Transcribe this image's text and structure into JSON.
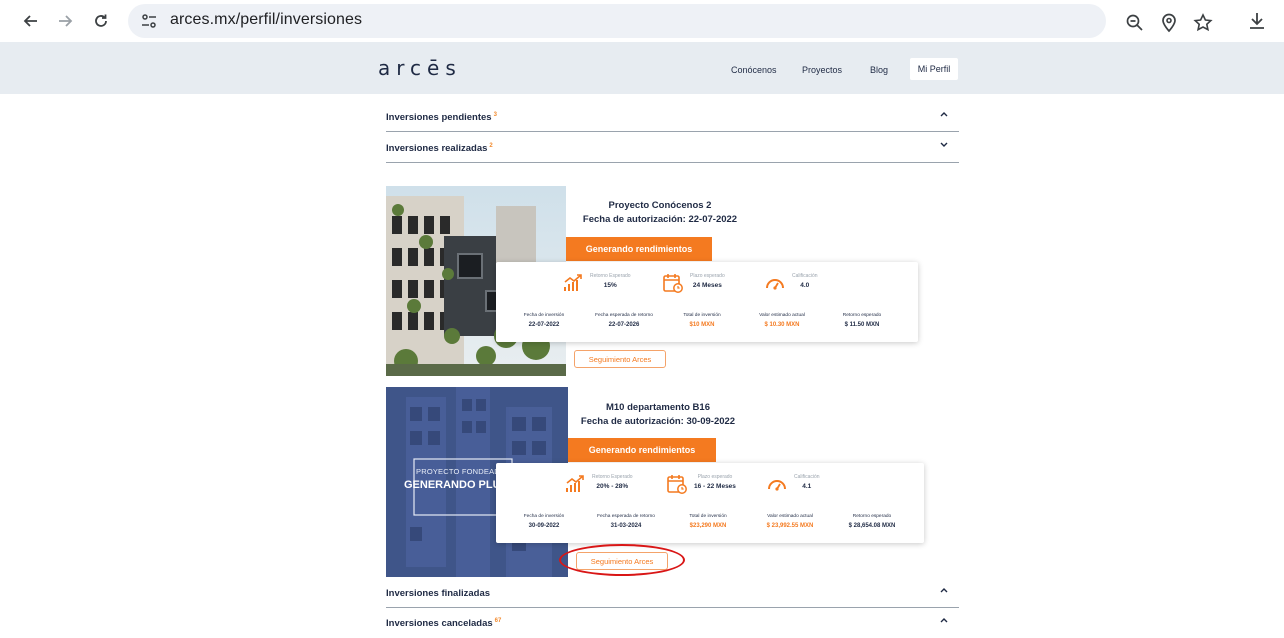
{
  "browser": {
    "url": "arces.mx/perfil/inversiones"
  },
  "site": {
    "logo": "arcēs",
    "nav": [
      "Conócenos",
      "Proyectos",
      "Blog"
    ],
    "profile_button": "Mi Perfil"
  },
  "sections": {
    "pending": {
      "label": "Inversiones pendientes",
      "count": "3"
    },
    "realized": {
      "label": "Inversiones realizadas",
      "count": "2"
    },
    "finished": {
      "label": "Inversiones finalizadas",
      "count": ""
    },
    "cancelled": {
      "label": "Inversiones canceladas",
      "count": "67"
    }
  },
  "projects": [
    {
      "name": "Proyecto Conócenos 2",
      "authorization": "Fecha de autorización: 22-07-2022",
      "status": "Generando rendimientos",
      "metrics": [
        {
          "label": "Retorno Esperado",
          "value": "15%"
        },
        {
          "label": "Plazo esperado",
          "value": "24 Meses"
        },
        {
          "label": "Calificación",
          "value": "4.0"
        }
      ],
      "columns": [
        {
          "label": "Fecha de inversión",
          "value": "22-07-2022"
        },
        {
          "label": "Fecha esperada de retorno",
          "value": "22-07-2026"
        },
        {
          "label": "Total de inversión",
          "value": "$10 MXN"
        },
        {
          "label": "Valor estimado actual",
          "value": "$ 10.30 MXN"
        },
        {
          "label": "Retorno esperado",
          "value": "$ 11.50 MXN"
        }
      ],
      "follow_button": "Seguimiento Arces"
    },
    {
      "name": "M10 departamento B16",
      "authorization": "Fecha de autorización: 30-09-2022",
      "status": "Generando rendimientos",
      "image_caption_small": "PROYECTO FONDEADO",
      "image_caption_big": "GENERANDO PLUSVALÍA",
      "metrics": [
        {
          "label": "Retorno Esperado",
          "value": "20% - 28%"
        },
        {
          "label": "Plazo esperado",
          "value": "16 - 22 Meses"
        },
        {
          "label": "Calificación",
          "value": "4.1"
        }
      ],
      "columns": [
        {
          "label": "Fecha de inversión",
          "value": "30-09-2022"
        },
        {
          "label": "Fecha esperada de retorno",
          "value": "31-03-2024"
        },
        {
          "label": "Total de inversión",
          "value": "$23,290 MXN"
        },
        {
          "label": "Valor estimado actual",
          "value": "$ 23,992.55 MXN"
        },
        {
          "label": "Retorno esperado",
          "value": "$ 28,654.08 MXN"
        }
      ],
      "follow_button": "Seguimiento Arces"
    }
  ],
  "colors": {
    "accent": "#f47a20",
    "header_bg": "#e7ecf1",
    "text": "#1f2a44",
    "highlight": "#d91616"
  }
}
